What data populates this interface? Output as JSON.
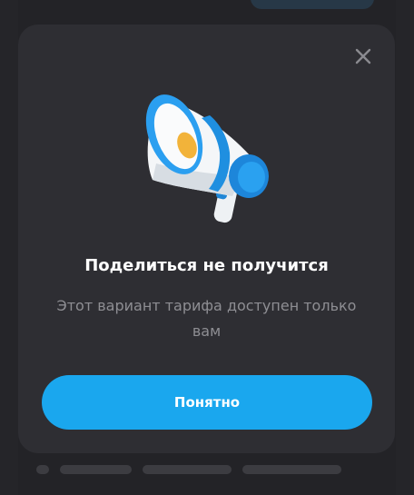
{
  "dialog": {
    "close_icon": "close-icon",
    "illustration_icon": "megaphone-icon",
    "title": "Поделиться не получится",
    "message": "Этот вариант тарифа доступен только вам",
    "confirm_label": "Понятно"
  },
  "colors": {
    "backdrop": "#232327",
    "modal_bg": "#2e2e33",
    "accent": "#1aa7ee",
    "title": "#ffffff",
    "message": "#8e8e93"
  }
}
